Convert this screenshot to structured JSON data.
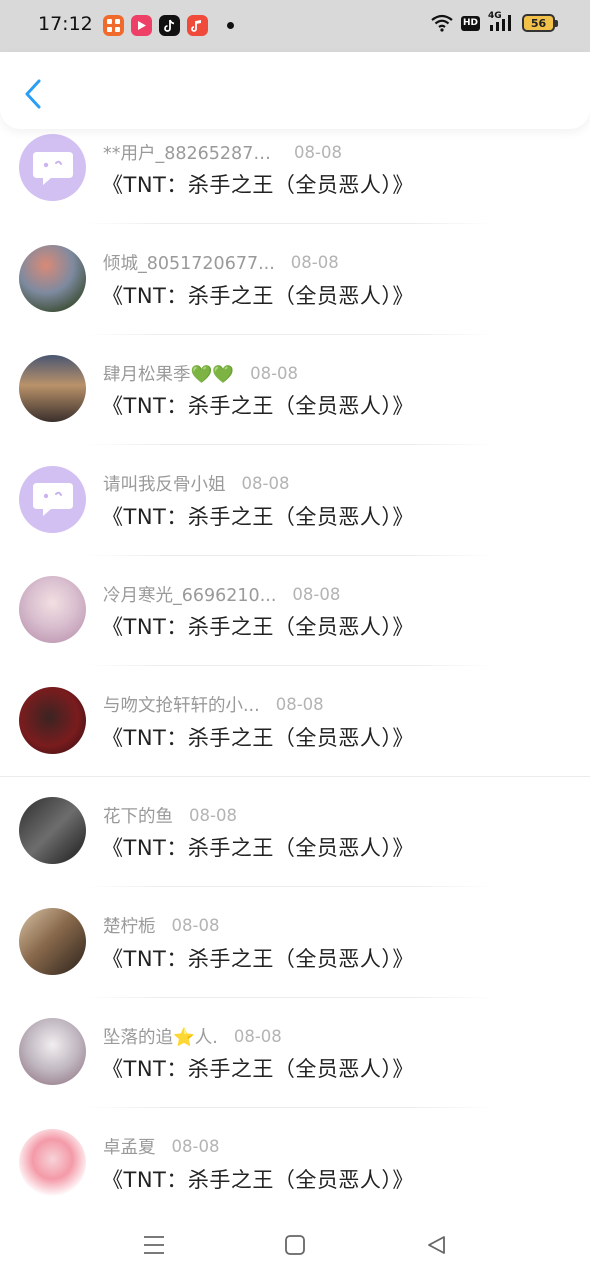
{
  "status_bar": {
    "time": "17:12",
    "app_icons": [
      {
        "name": "app-icon-1",
        "color": "#f06a2b"
      },
      {
        "name": "video-app-icon",
        "color": "#ee3f66"
      },
      {
        "name": "tiktok-icon",
        "color": "#111111"
      },
      {
        "name": "music-app-icon",
        "color": "#f04b3a"
      }
    ],
    "network": "4G",
    "hd_label": "HD",
    "battery": "56"
  },
  "header": {
    "back_icon": "chevron-left-icon",
    "accent_color": "#2a9df4"
  },
  "items": [
    {
      "name": "**用户_882652872...",
      "date": "08-08",
      "title": "《TNT：杀手之王（全员恶人）》",
      "avatar": "default"
    },
    {
      "name": "倾城_8051720677...",
      "date": "08-08",
      "title": "《TNT：杀手之王（全员恶人）》",
      "avatar": "photo"
    },
    {
      "name": "肆月松果季💚💚",
      "date": "08-08",
      "title": "《TNT：杀手之王（全员恶人）》",
      "avatar": "photo"
    },
    {
      "name": "请叫我反骨小姐",
      "date": "08-08",
      "title": "《TNT：杀手之王（全员恶人）》",
      "avatar": "default"
    },
    {
      "name": "冷月寒光_6696210...",
      "date": "08-08",
      "title": "《TNT：杀手之王（全员恶人）》",
      "avatar": "photo"
    },
    {
      "name": "与吻文抢轩轩的小...",
      "date": "08-08",
      "title": "《TNT：杀手之王（全员恶人）》",
      "avatar": "photo"
    },
    {
      "name": "花下的鱼",
      "date": "08-08",
      "title": "《TNT：杀手之王（全员恶人）》",
      "avatar": "photo"
    },
    {
      "name": "楚柠栀",
      "date": "08-08",
      "title": "《TNT：杀手之王（全员恶人）》",
      "avatar": "photo"
    },
    {
      "name": "坠落的追⭐人.",
      "date": "08-08",
      "title": "《TNT：杀手之王（全员恶人）》",
      "avatar": "photo"
    },
    {
      "name": "卓孟夏",
      "date": "08-08",
      "title": "《TNT：杀手之王（全员恶人）》",
      "avatar": "photo"
    }
  ],
  "bottom_nav": {
    "menu_icon": "menu-icon",
    "home_icon": "home-square-icon",
    "back_icon": "back-triangle-icon"
  }
}
